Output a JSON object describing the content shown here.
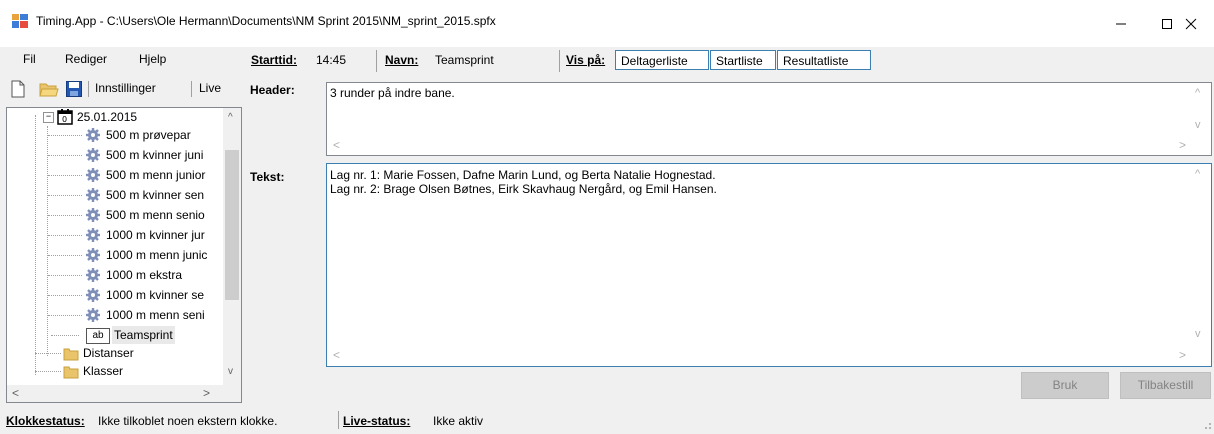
{
  "window": {
    "title": "Timing.App - C:\\Users\\Ole Hermann\\Documents\\NM Sprint 2015\\NM_sprint_2015.spfx"
  },
  "menu": {
    "items": [
      "Fil",
      "Rediger",
      "Hjelp"
    ]
  },
  "toolbar": {
    "settings_label": "Innstillinger",
    "live_label": "Live"
  },
  "event": {
    "starttid_label": "Starttid:",
    "starttid_value": "14:45",
    "navn_label": "Navn:",
    "navn_value": "Teamsprint",
    "vispaa_label": "Vis på:",
    "vispaa_buttons": [
      "Deltagerliste",
      "Startliste",
      "Resultatliste"
    ]
  },
  "tree": {
    "date": "25.01.2015",
    "events": [
      "500 m prøvepar",
      "500 m kvinner juni",
      "500 m menn junior",
      "500 m kvinner sen",
      "500 m menn senio",
      "1000 m kvinner jur",
      "1000 m menn junic",
      "1000 m ekstra",
      "1000 m kvinner se",
      "1000 m menn seni"
    ],
    "text_node_badge": "ab",
    "text_node_label": "Teamsprint",
    "folders": [
      "Distanser",
      "Klasser"
    ]
  },
  "editor": {
    "header_label": "Header:",
    "header_text": "3 runder på indre bane.",
    "tekst_label": "Tekst:",
    "tekst_lines": [
      "Lag nr. 1: Marie Fossen, Dafne Marin Lund, og Berta Natalie Hognestad.",
      "Lag nr. 2: Brage Olsen Bøtnes, Eirk Skavhaug Nergård, og Emil Hansen."
    ],
    "bruk_label": "Bruk",
    "tilbakestill_label": "Tilbakestill"
  },
  "status": {
    "klokke_label": "Klokkestatus:",
    "klokke_value": "Ikke tilkoblet noen ekstern klokke.",
    "live_label": "Live-status:",
    "live_value": "Ikke aktiv"
  },
  "icons": {
    "app": "app-icon",
    "new": "new-file-icon",
    "open": "open-folder-icon",
    "save": "save-disk-icon",
    "gear": "gear-icon",
    "calendar": "calendar-icon",
    "folder": "folder-icon"
  }
}
